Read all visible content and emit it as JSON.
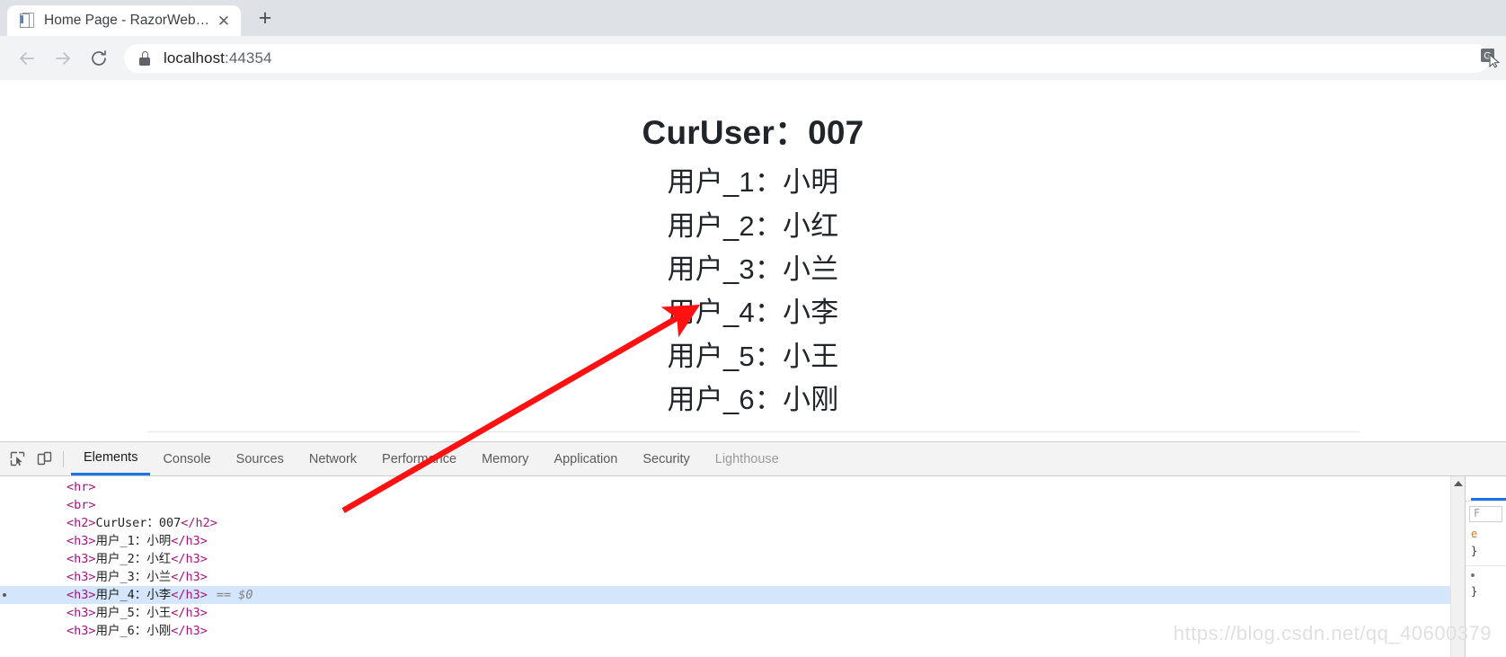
{
  "browser": {
    "tab": {
      "title": "Home Page - RazorWebApp",
      "close_label": "✕",
      "favicon_name": "page-favicon"
    },
    "new_tab_label": "+",
    "nav": {
      "back_label": "back",
      "forward_label": "forward",
      "reload_label": "reload"
    },
    "omnibox": {
      "url_host": "localhost",
      "url_port": ":44354",
      "full_url": "localhost:44354",
      "lock_icon": "lock-icon"
    },
    "translate_icon": "translate-icon"
  },
  "page": {
    "heading": "CurUser：007",
    "users": [
      "用户_1：小明",
      "用户_2：小红",
      "用户_3：小兰",
      "用户_4：小李",
      "用户_5：小王",
      "用户_6：小刚"
    ]
  },
  "devtools": {
    "icons": {
      "inspect": "inspect-element-icon",
      "device": "device-toolbar-icon"
    },
    "tabs": [
      {
        "label": "Elements",
        "active": true
      },
      {
        "label": "Console",
        "active": false
      },
      {
        "label": "Sources",
        "active": false
      },
      {
        "label": "Network",
        "active": false
      },
      {
        "label": "Performance",
        "active": false
      },
      {
        "label": "Memory",
        "active": false
      },
      {
        "label": "Application",
        "active": false
      },
      {
        "label": "Security",
        "active": false
      },
      {
        "label": "Lighthouse",
        "active": false
      }
    ],
    "dom_rows": [
      {
        "open": "<hr>",
        "text": "",
        "close": "",
        "suffix": "",
        "selected": false
      },
      {
        "open": "<br>",
        "text": "",
        "close": "",
        "suffix": "",
        "selected": false
      },
      {
        "open": "<h2>",
        "text": "CurUser：007",
        "close": "</h2>",
        "suffix": "",
        "selected": false
      },
      {
        "open": "<h3>",
        "text": "用户_1：小明",
        "close": "</h3>",
        "suffix": "",
        "selected": false
      },
      {
        "open": "<h3>",
        "text": "用户_2：小红",
        "close": "</h3>",
        "suffix": "",
        "selected": false
      },
      {
        "open": "<h3>",
        "text": "用户_3：小兰",
        "close": "</h3>",
        "suffix": "",
        "selected": false
      },
      {
        "open": "<h3>",
        "text": "用户_4：小李",
        "close": "</h3>",
        "suffix": "== $0",
        "selected": true
      },
      {
        "open": "<h3>",
        "text": "用户_5：小王",
        "close": "</h3>",
        "suffix": "",
        "selected": false
      },
      {
        "open": "<h3>",
        "text": "用户_6：小刚",
        "close": "</h3>",
        "suffix": "",
        "selected": false
      }
    ],
    "styles": {
      "tab_label": "",
      "filter_placeholder": "F",
      "lines": [
        "e",
        "}",
        "",
        "}"
      ]
    }
  },
  "watermark": "https://blog.csdn.net/qq_40600379",
  "colors": {
    "accent": "#1a73e8",
    "tabstrip": "#dee1e6",
    "toolbar": "#f1f3f4",
    "selection": "#d3e6fb",
    "arrow": "#ff0000",
    "tag": "#a3157d"
  }
}
